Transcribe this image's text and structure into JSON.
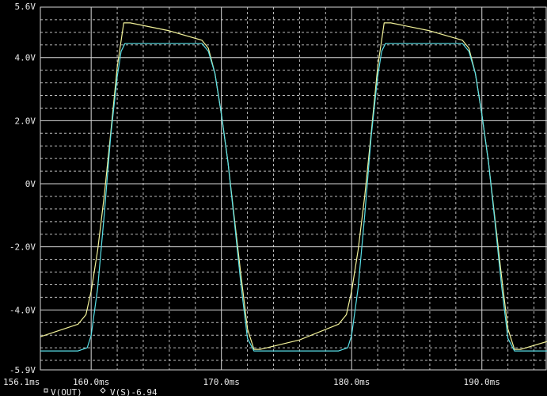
{
  "colors": {
    "background": "#000000",
    "grid_major": "#d8d8d8",
    "grid_minor": "#bcbcbc",
    "text": "#e8e8e8",
    "series_out": "#f3f39a",
    "series_s": "#59e0e8"
  },
  "chart_data": {
    "type": "line",
    "title": "",
    "xlabel": "",
    "ylabel": "",
    "grid": true,
    "legend_placement": "bottom-left",
    "xlim": [
      156.1,
      195.0
    ],
    "ylim": [
      -5.9,
      5.6
    ],
    "x_ticks": [
      {
        "value": 156.1,
        "label": "156.1ms"
      },
      {
        "value": 160.0,
        "label": "160.0ms"
      },
      {
        "value": 170.0,
        "label": "170.0ms"
      },
      {
        "value": 180.0,
        "label": "180.0ms"
      },
      {
        "value": 190.0,
        "label": "190.0ms"
      }
    ],
    "y_ticks": [
      {
        "value": 5.6,
        "label": "5.6V"
      },
      {
        "value": 4.0,
        "label": "4.0V"
      },
      {
        "value": 2.0,
        "label": "2.0V"
      },
      {
        "value": 0.0,
        "label": "0V"
      },
      {
        "value": -2.0,
        "label": "-2.0V"
      },
      {
        "value": -4.0,
        "label": "-4.0V"
      },
      {
        "value": -5.9,
        "label": "-5.9V"
      }
    ],
    "series": [
      {
        "name": "V(OUT)",
        "marker": "square",
        "color": "#f3f39a",
        "x": [
          156.1,
          159.0,
          159.6,
          160.0,
          160.5,
          161.0,
          161.5,
          162.0,
          162.5,
          163.0,
          166.0,
          168.5,
          169.0,
          169.5,
          170.0,
          170.5,
          171.0,
          171.5,
          172.0,
          172.5,
          173.0,
          176.0,
          179.0,
          179.6,
          180.0,
          180.5,
          181.0,
          181.5,
          182.0,
          182.5,
          183.0,
          186.0,
          188.5,
          189.0,
          189.5,
          190.0,
          190.5,
          191.0,
          191.5,
          192.0,
          192.5,
          193.0,
          195.0
        ],
        "y": [
          -4.85,
          -4.45,
          -4.15,
          -3.4,
          -2.1,
          -0.4,
          1.6,
          3.7,
          5.1,
          5.1,
          4.85,
          4.55,
          4.3,
          3.5,
          2.2,
          0.7,
          -1.1,
          -2.9,
          -4.6,
          -5.25,
          -5.25,
          -4.95,
          -4.45,
          -4.15,
          -3.4,
          -2.1,
          -0.4,
          1.6,
          3.7,
          5.1,
          5.1,
          4.85,
          4.55,
          4.3,
          3.5,
          2.2,
          0.7,
          -1.1,
          -2.9,
          -4.6,
          -5.25,
          -5.25,
          -5.0
        ]
      },
      {
        "name": "V(S)-6.94",
        "marker": "diamond",
        "color": "#59e0e8",
        "x": [
          156.1,
          159.0,
          159.7,
          160.0,
          160.5,
          161.0,
          161.5,
          162.0,
          162.3,
          162.6,
          163.0,
          166.0,
          168.5,
          169.0,
          169.5,
          170.0,
          170.5,
          171.0,
          171.5,
          172.0,
          172.5,
          176.0,
          179.0,
          179.7,
          180.0,
          180.5,
          181.0,
          181.5,
          182.0,
          182.3,
          182.6,
          183.0,
          186.0,
          188.5,
          189.0,
          189.5,
          190.0,
          190.5,
          191.0,
          191.5,
          192.0,
          192.5,
          195.0
        ],
        "y": [
          -5.3,
          -5.3,
          -5.2,
          -4.8,
          -3.3,
          -1.0,
          1.5,
          3.4,
          4.2,
          4.45,
          4.45,
          4.45,
          4.45,
          4.2,
          3.5,
          2.2,
          0.7,
          -1.2,
          -3.2,
          -4.9,
          -5.3,
          -5.3,
          -5.3,
          -5.2,
          -4.8,
          -3.3,
          -1.0,
          1.5,
          3.4,
          4.2,
          4.45,
          4.45,
          4.45,
          4.45,
          4.2,
          3.5,
          2.2,
          0.7,
          -1.2,
          -3.2,
          -4.9,
          -5.3,
          -5.3
        ]
      }
    ]
  }
}
